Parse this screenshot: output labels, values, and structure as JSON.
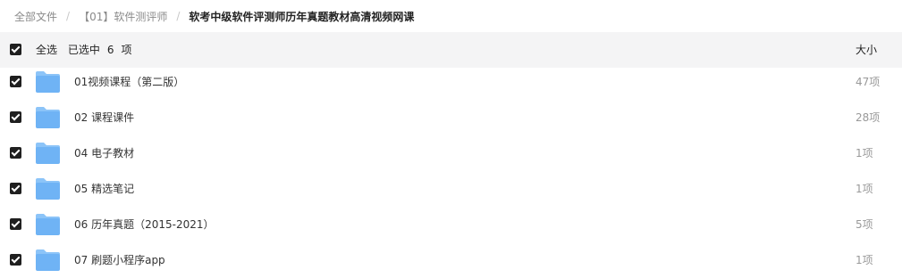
{
  "breadcrumb": {
    "items": [
      "全部文件",
      "【01】软件测评师"
    ],
    "current": "软考中级软件评测师历年真题教材高清视频网课"
  },
  "header": {
    "select_all": "全选",
    "selected_prefix": "已选中",
    "selected_count": "6",
    "selected_suffix": "项",
    "size_column": "大小"
  },
  "files": [
    {
      "name": "01视频课程（第二版）",
      "size": "47项",
      "checked": true,
      "icon": "folder-icon"
    },
    {
      "name": "02 课程课件",
      "size": "28项",
      "checked": true,
      "icon": "folder-icon"
    },
    {
      "name": "04 电子教材",
      "size": "1项",
      "checked": true,
      "icon": "folder-icon"
    },
    {
      "name": "05 精选笔记",
      "size": "1项",
      "checked": true,
      "icon": "folder-icon"
    },
    {
      "name": "06 历年真题（2015-2021）",
      "size": "5项",
      "checked": true,
      "icon": "folder-icon"
    },
    {
      "name": "07 刷题小程序app",
      "size": "1项",
      "checked": true,
      "icon": "folder-icon"
    }
  ],
  "colors": {
    "folder_body": "#6fb3f5",
    "folder_back": "#8cc4f8",
    "checkbox": "#1f1f1f",
    "header_bg": "#f4f4f5"
  }
}
